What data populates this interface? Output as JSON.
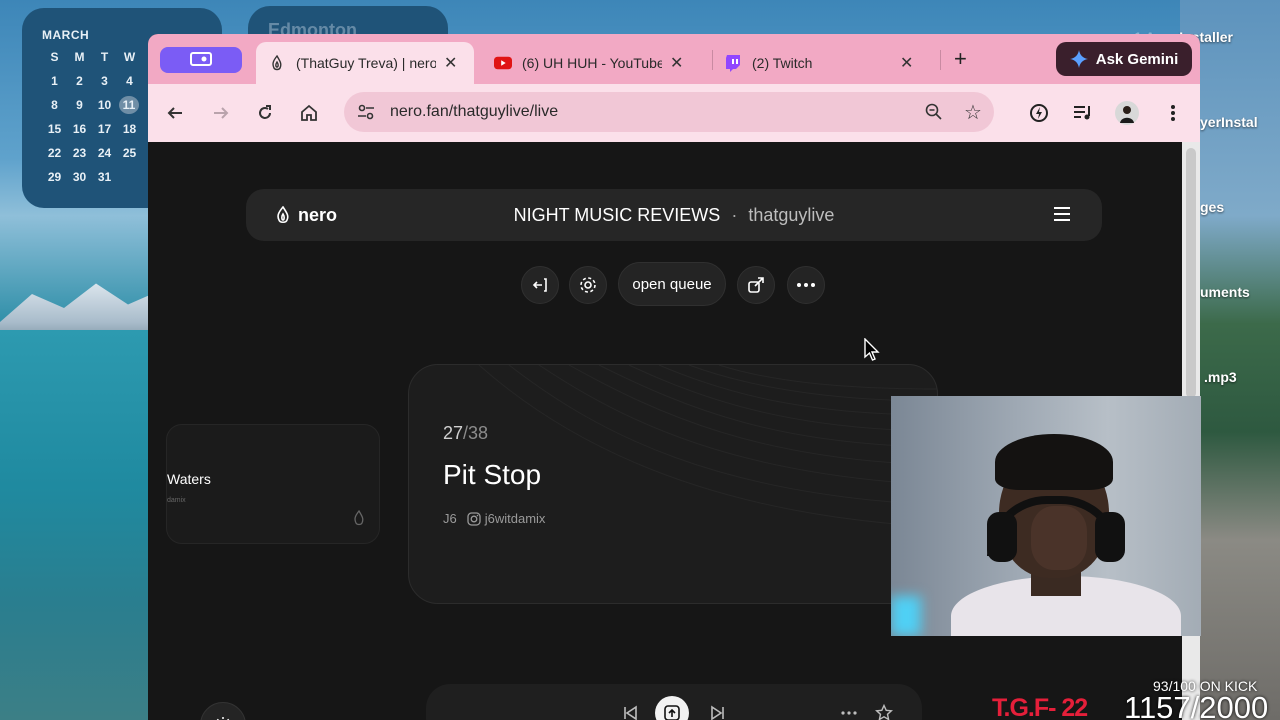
{
  "calendar": {
    "month": "MARCH",
    "weekdays": [
      "S",
      "M",
      "T",
      "W"
    ],
    "rows": [
      [
        "1",
        "2",
        "3",
        "4"
      ],
      [
        "8",
        "9",
        "10",
        "11"
      ],
      [
        "15",
        "16",
        "17",
        "18"
      ],
      [
        "22",
        "23",
        "24",
        "25"
      ],
      [
        "29",
        "30",
        "31",
        ""
      ]
    ],
    "today": "11"
  },
  "weather_widget": {
    "city": "Edmonton"
  },
  "desktop_labels": {
    "installer": "Installer",
    "installer_prefix": "1 A",
    "player_installer": "yerInstal",
    "images": "ges",
    "documents": "uments",
    "mp3": ".mp3"
  },
  "browser": {
    "tabs": [
      {
        "title": "(ThatGuy Treva) | nero"
      },
      {
        "title": "(6) UH HUH - YouTube"
      },
      {
        "title": "(2) Twitch"
      }
    ],
    "new_tab": "+",
    "gemini_label": "Ask Gemini",
    "url": "nero.fan/thatguylive/live"
  },
  "page": {
    "logo_text": "nero",
    "show_name": "NIGHT MUSIC REVIEWS",
    "separator": "·",
    "host": "thatguylive",
    "ghost_logo": "nero",
    "queue_button": "open queue",
    "track": {
      "index": "27",
      "total": "/38",
      "title": "Pit Stop",
      "artist": "J6",
      "handle": "j6witdamix"
    },
    "prev_card": {
      "title": "Waters",
      "sub": "damix"
    }
  },
  "overlay": {
    "tgf": "T.G.F- 22",
    "kick_small": "93/100 ON KICK",
    "kick_big": "1157/2000"
  },
  "colors": {
    "tab_strip": "#f2a9c4",
    "toolbar": "#fbe0ea",
    "tab_group": "#7b5cf5",
    "page_bg": "#161616",
    "overlay_red": "#e51f3a"
  }
}
